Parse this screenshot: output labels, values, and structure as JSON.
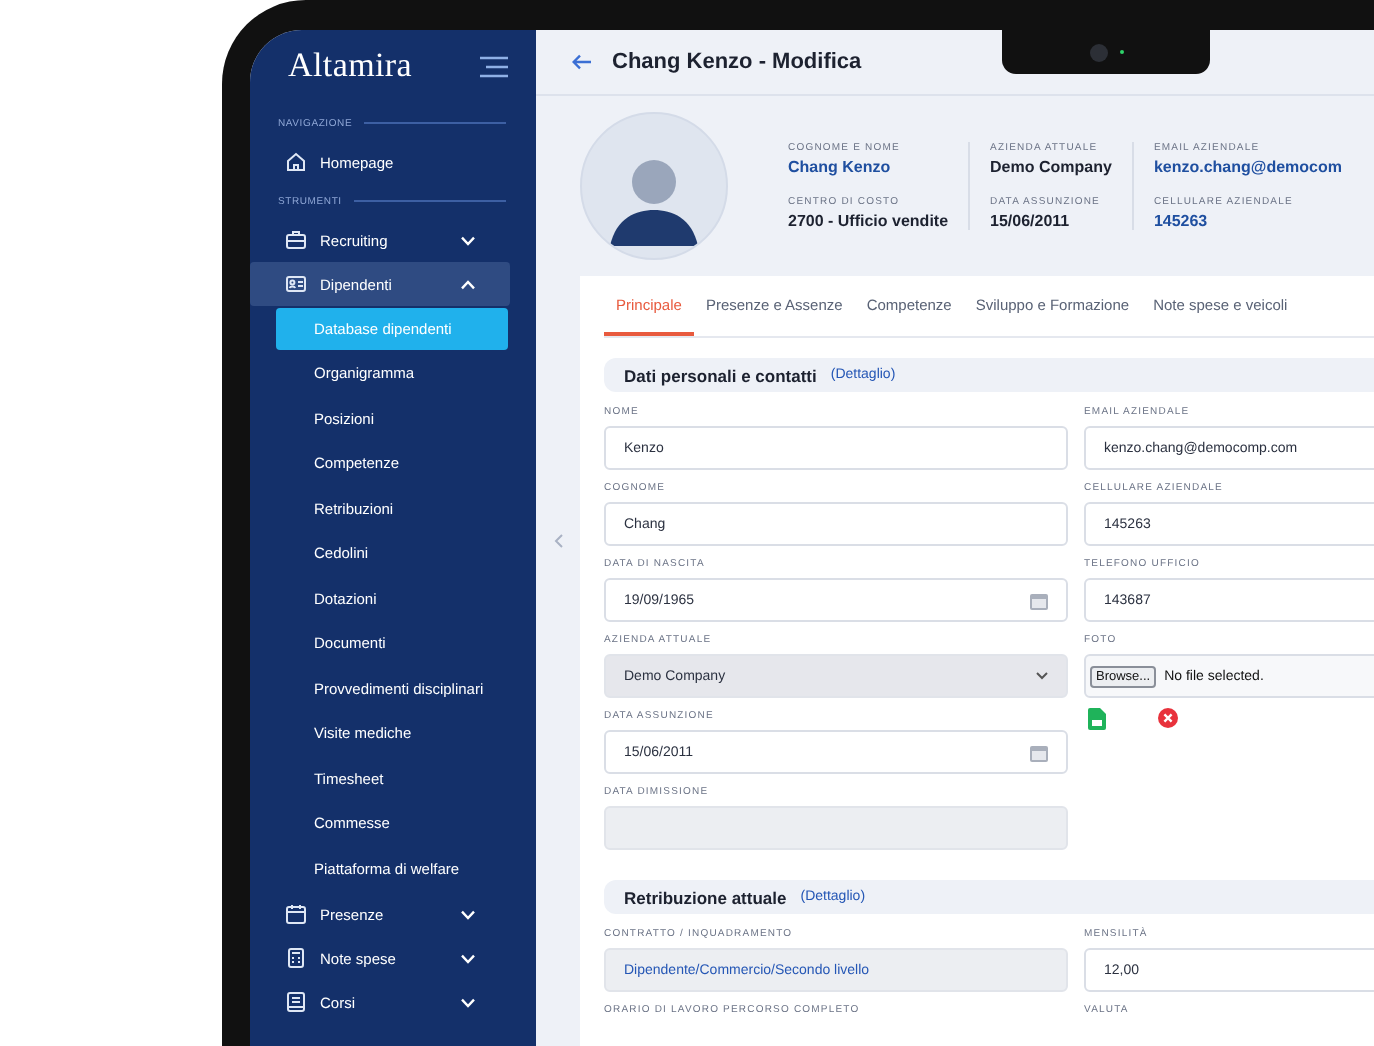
{
  "sidebar": {
    "logo": "Altamira",
    "sections": [
      {
        "label": "NAVIGAZIONE",
        "items": [
          {
            "label": "Homepage"
          }
        ]
      },
      {
        "label": "STRUMENTI",
        "items": [
          {
            "label": "Recruiting",
            "expanded": false
          },
          {
            "label": "Dipendenti",
            "expanded": true,
            "children": [
              {
                "label": "Database dipendenti",
                "selected": true
              },
              {
                "label": "Organigramma",
                "selected": false
              },
              {
                "label": "Posizioni",
                "selected": false
              },
              {
                "label": "Competenze",
                "selected": false
              },
              {
                "label": "Retribuzioni",
                "selected": false
              },
              {
                "label": "Cedolini",
                "selected": false
              },
              {
                "label": "Dotazioni",
                "selected": false
              },
              {
                "label": "Documenti",
                "selected": false
              },
              {
                "label": "Provvedimenti disciplinari",
                "selected": false
              },
              {
                "label": "Visite mediche",
                "selected": false
              },
              {
                "label": "Timesheet",
                "selected": false
              },
              {
                "label": "Commesse",
                "selected": false
              },
              {
                "label": "Piattaforma di welfare",
                "selected": false
              }
            ]
          },
          {
            "label": "Presenze",
            "expanded": false
          },
          {
            "label": "Note spese",
            "expanded": false
          },
          {
            "label": "Corsi",
            "expanded": false
          }
        ]
      }
    ]
  },
  "header": {
    "title": "Chang Kenzo - Modifica"
  },
  "profile": {
    "columns": [
      [
        {
          "label": "COGNOME E NOME",
          "value": "Chang Kenzo",
          "kind": "link"
        },
        {
          "label": "CENTRO DI COSTO",
          "value": "2700 - Ufficio vendite",
          "kind": "plain"
        }
      ],
      [
        {
          "label": "AZIENDA ATTUALE",
          "value": "Demo Company",
          "kind": "plain"
        },
        {
          "label": "DATA ASSUNZIONE",
          "value": "15/06/2011",
          "kind": "plain"
        }
      ],
      [
        {
          "label": "EMAIL AZIENDALE",
          "value": "kenzo.chang@democom",
          "kind": "link"
        },
        {
          "label": "CELLULARE AZIENDALE",
          "value": "145263",
          "kind": "link"
        }
      ]
    ]
  },
  "tabs": [
    {
      "label": "Principale",
      "selected": true
    },
    {
      "label": "Presenze e Assenze",
      "selected": false
    },
    {
      "label": "Competenze",
      "selected": false
    },
    {
      "label": "Sviluppo e Formazione",
      "selected": false
    },
    {
      "label": "Note spese e veicoli",
      "selected": false
    }
  ],
  "sections": [
    {
      "title": "Dati personali e contatti",
      "link": "(Dettaglio)",
      "left": [
        {
          "label": "NOME",
          "kind": "text",
          "value": "Kenzo",
          "readonly": false
        },
        {
          "label": "COGNOME",
          "kind": "text",
          "value": "Chang",
          "readonly": false
        },
        {
          "label": "DATA DI NASCITA",
          "kind": "date",
          "value": "19/09/1965",
          "readonly": false
        },
        {
          "label": "AZIENDA ATTUALE",
          "kind": "select",
          "value": "Demo Company",
          "readonly": true
        },
        {
          "label": "DATA ASSUNZIONE",
          "kind": "date",
          "value": "15/06/2011",
          "readonly": false
        },
        {
          "label": "DATA DIMISSIONE",
          "kind": "text",
          "readonly": true
        }
      ],
      "right": [
        {
          "label": "EMAIL AZIENDALE",
          "kind": "text",
          "value": "kenzo.chang@democomp.com",
          "readonly": false
        },
        {
          "label": "CELLULARE AZIENDALE",
          "kind": "text",
          "value": "145263",
          "readonly": false
        },
        {
          "label": "TELEFONO UFFICIO",
          "kind": "text",
          "value": "143687",
          "readonly": false
        },
        {
          "label": "FOTO",
          "kind": "file",
          "button": "Browse...",
          "value": "No file selected.",
          "readonly": false
        }
      ]
    },
    {
      "title": "Retribuzione attuale",
      "link": "(Dettaglio)",
      "left": [
        {
          "label": "CONTRATTO / INQUADRAMENTO",
          "kind": "link",
          "value": "Dipendente/Commercio/Secondo livello",
          "readonly": true
        },
        {
          "label": "ORARIO DI LAVORO PERCORSO COMPLETO"
        }
      ],
      "right": [
        {
          "label": "MENSILITÀ",
          "kind": "text",
          "value": "12,00",
          "readonly": false
        },
        {
          "label": "VALUTA"
        }
      ]
    }
  ]
}
